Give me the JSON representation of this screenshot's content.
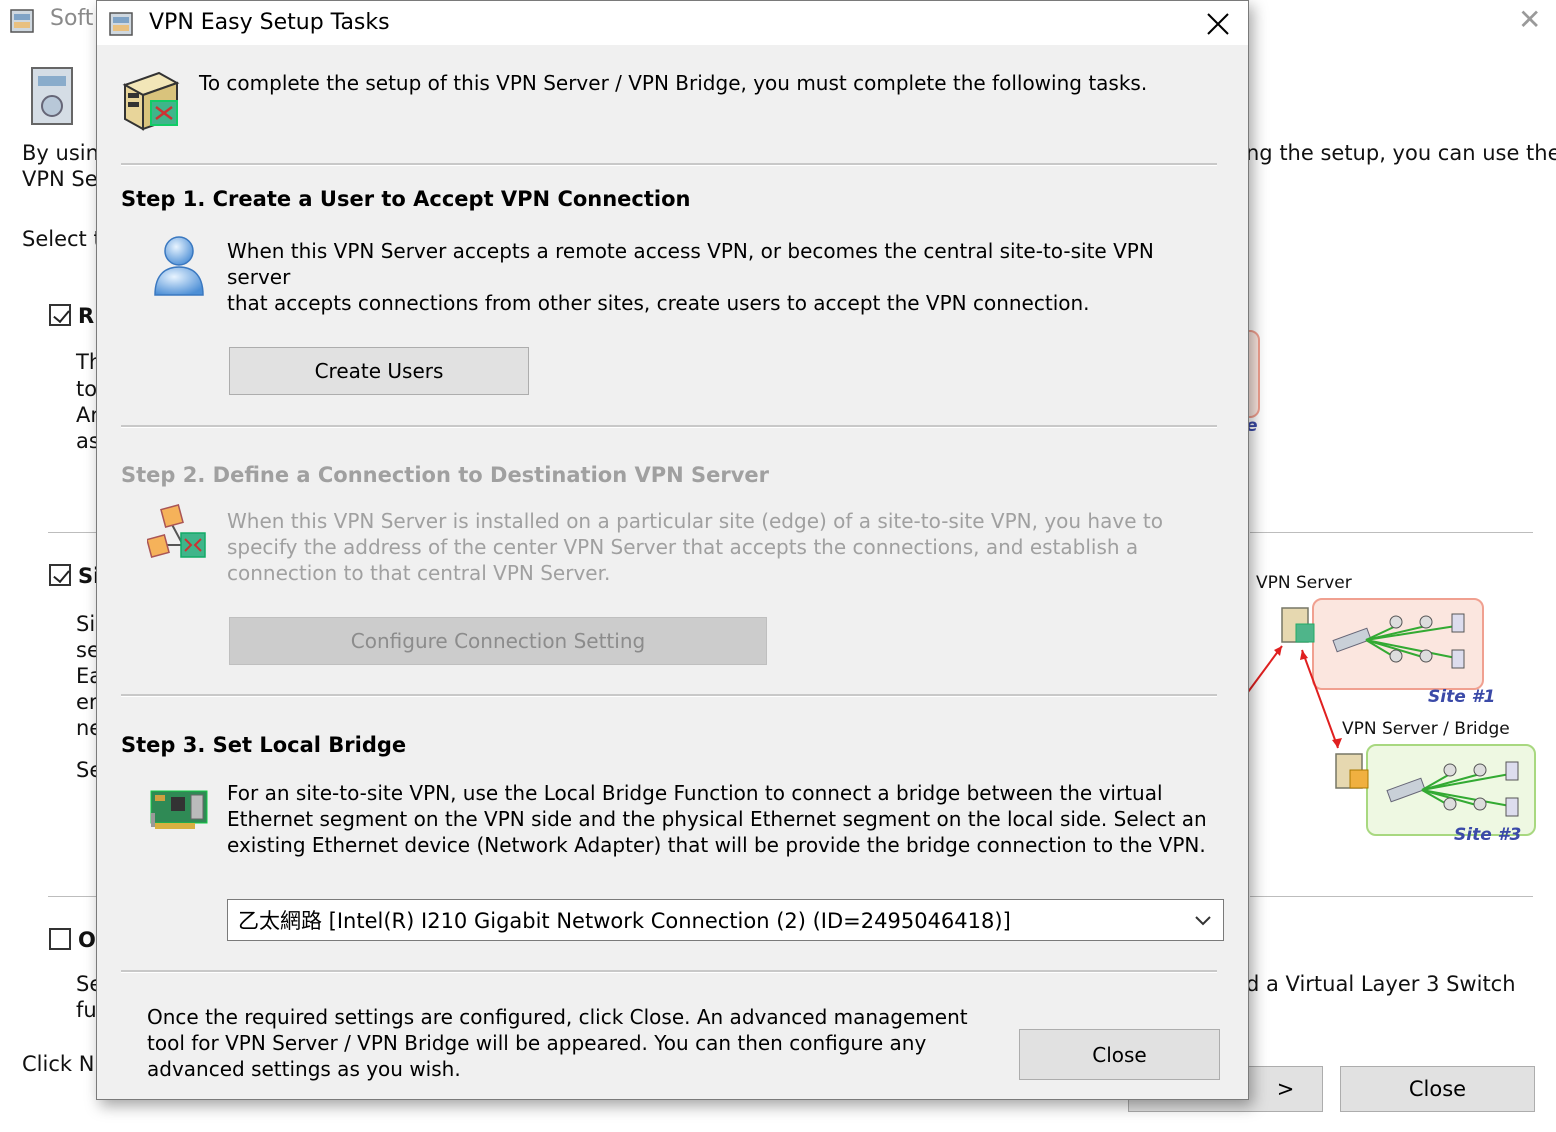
{
  "background_window": {
    "title_fragment": "Soft",
    "text_fragments": {
      "by_using": "By using",
      "vpn_se": "VPN Se",
      "select_t": "Select t",
      "opt1_label": "R",
      "opt1_lines": [
        "Th",
        "to",
        "Ar",
        "as"
      ],
      "opt2_label": "Si",
      "opt2_lines": [
        "Si",
        "se",
        "Ea",
        "er",
        "ne"
      ],
      "opt2_se": "Se",
      "opt3_label": "O",
      "opt3_lines": [
        "Se",
        "fu"
      ],
      "click_next": "Click N",
      "right_setup": "ng the setup, you can use the",
      "right_switch": "d a Virtual Layer 3 Switch",
      "diagram_e": "e"
    },
    "options": [
      {
        "checked": true
      },
      {
        "checked": true
      },
      {
        "checked": false
      }
    ],
    "diagram": {
      "server_label": "VPN Server",
      "bridge_label": "VPN Server / Bridge",
      "site1": "Site #1",
      "site3": "Site #3"
    },
    "next_button_fragment": ">",
    "close_button": "Close"
  },
  "dialog": {
    "title": "VPN Easy Setup Tasks",
    "intro": "To complete the setup of this VPN Server / VPN Bridge, you must complete the following tasks.",
    "step1": {
      "title": "Step 1. Create a User to Accept VPN Connection",
      "lines": [
        "When this VPN Server accepts a remote access VPN, or becomes the central site-to-site VPN server",
        "that accepts connections from other sites, create users to accept the VPN connection."
      ],
      "button": "Create Users",
      "icon": "user-icon"
    },
    "step2": {
      "title": "Step 2. Define a Connection to Destination VPN Server",
      "lines": [
        "When this VPN Server is installed on a particular site (edge) of a site-to-site VPN, you have to",
        "specify the address of the center VPN Server that accepts the connections, and establish a",
        "connection to that central VPN Server."
      ],
      "button": "Configure Connection Setting",
      "enabled": false,
      "icon": "network-connection-icon"
    },
    "step3": {
      "title": "Step 3. Set Local Bridge",
      "lines": [
        "For an site-to-site VPN, use the Local Bridge Function to connect a bridge between the virtual",
        "Ethernet segment on the VPN side and the physical Ethernet segment on the local side. Select an",
        "existing Ethernet device (Network Adapter) that will be provide the bridge connection to the VPN."
      ],
      "selected_adapter": "乙太網路 [Intel(R) I210 Gigabit Network Connection (2) (ID=2495046418)]",
      "icon": "network-card-icon"
    },
    "footer": {
      "lines": [
        "Once the required settings are configured, click Close. An advanced management",
        "tool for VPN Server / VPN Bridge will be appeared. You can then configure any",
        "advanced settings as you wish."
      ],
      "close_button": "Close"
    },
    "colors": {
      "dialog_bg": "#f0f0f0",
      "disabled_text": "#a0a0a0",
      "button_bg": "#e1e1e1"
    }
  }
}
